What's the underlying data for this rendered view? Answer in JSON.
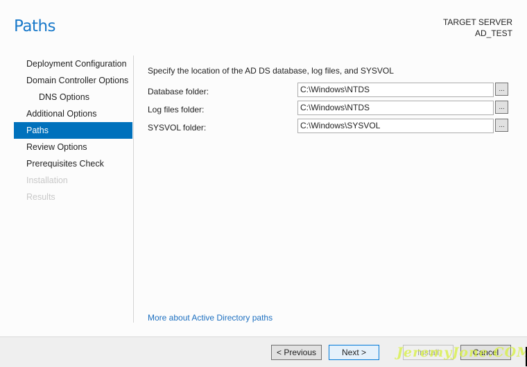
{
  "header": {
    "title": "Paths",
    "target_server_label": "TARGET SERVER",
    "target_server_name": "AD_TEST"
  },
  "nav": {
    "items": [
      {
        "label": "Deployment Configuration",
        "state": "normal"
      },
      {
        "label": "Domain Controller Options",
        "state": "normal"
      },
      {
        "label": "DNS Options",
        "state": "sub"
      },
      {
        "label": "Additional Options",
        "state": "normal"
      },
      {
        "label": "Paths",
        "state": "active"
      },
      {
        "label": "Review Options",
        "state": "normal"
      },
      {
        "label": "Prerequisites Check",
        "state": "normal"
      },
      {
        "label": "Installation",
        "state": "disabled"
      },
      {
        "label": "Results",
        "state": "disabled"
      }
    ]
  },
  "main": {
    "description": "Specify the location of the AD DS database, log files, and SYSVOL",
    "fields": [
      {
        "label": "Database folder:",
        "value": "C:\\Windows\\NTDS",
        "browse_label": "..."
      },
      {
        "label": "Log files folder:",
        "value": "C:\\Windows\\NTDS",
        "browse_label": "..."
      },
      {
        "label": "SYSVOL folder:",
        "value": "C:\\Windows\\SYSVOL",
        "browse_label": "..."
      }
    ],
    "more_link": "More about Active Directory paths"
  },
  "footer": {
    "previous_label": "< Previous",
    "next_label": "Next >",
    "install_label": "Install",
    "cancel_label": "Cancel"
  },
  "watermark": "JeremyJone.COM",
  "colors": {
    "accent": "#0071bc",
    "title": "#1979ca",
    "link": "#1c6fc0"
  }
}
